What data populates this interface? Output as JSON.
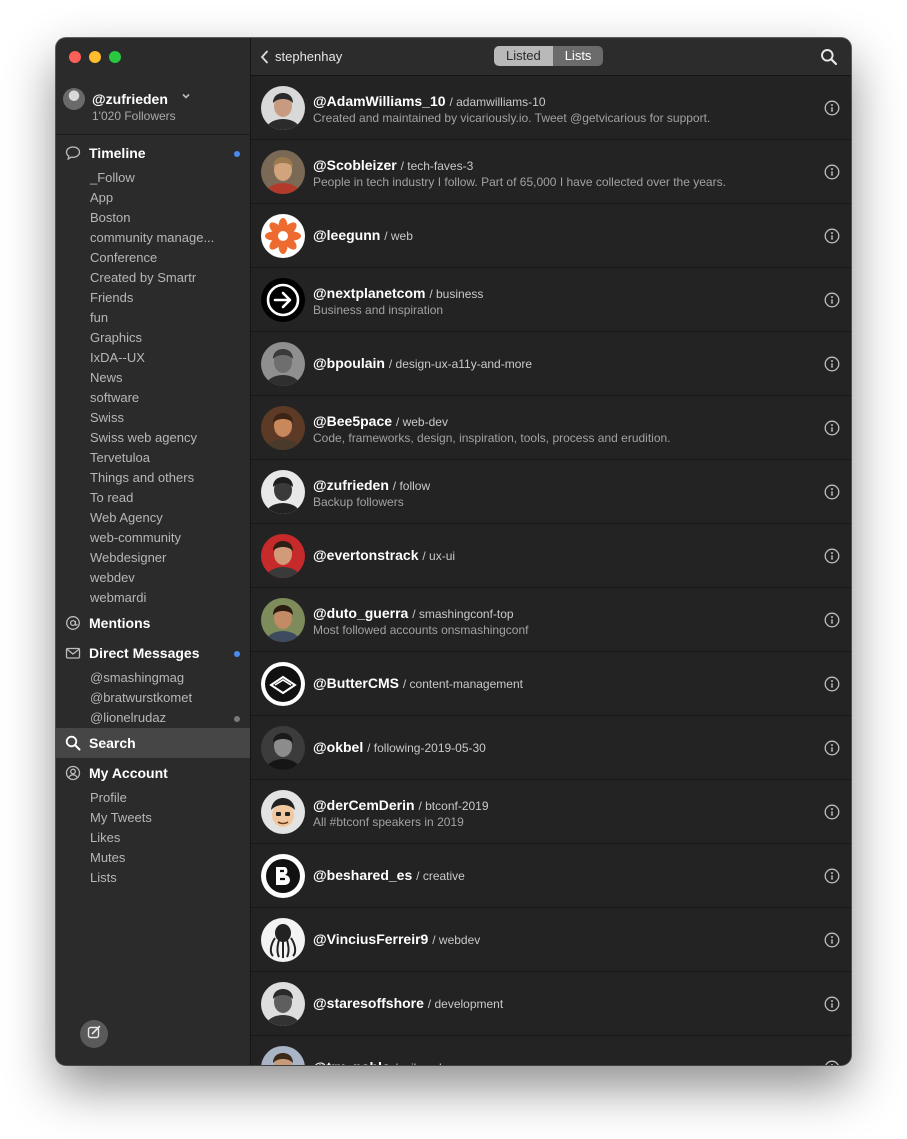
{
  "sidebar": {
    "account": {
      "handle": "@zufrieden",
      "followers": "1'020 Followers"
    },
    "timeline": {
      "label": "Timeline",
      "lists": [
        "_Follow",
        "App",
        "Boston",
        "community manage...",
        "Conference",
        "Created by Smartr",
        "Friends",
        "fun",
        "Graphics",
        "IxDA--UX",
        "News",
        "software",
        "Swiss",
        "Swiss web agency",
        "Tervetuloa",
        "Things and others",
        "To read",
        "Web Agency",
        "web-community",
        "Webdesigner",
        "webdev",
        "webmardi"
      ]
    },
    "mentions": {
      "label": "Mentions"
    },
    "direct_messages": {
      "label": "Direct Messages",
      "threads": [
        "@smashingmag",
        "@bratwurstkomet",
        "@lionelrudaz"
      ]
    },
    "search": {
      "label": "Search"
    },
    "my_account": {
      "label": "My Account",
      "items": [
        "Profile",
        "My Tweets",
        "Likes",
        "Mutes",
        "Lists"
      ]
    }
  },
  "header": {
    "back_label": "stephenhay",
    "segments": [
      "Listed",
      "Lists"
    ]
  },
  "rows": [
    {
      "handle": "@AdamWilliams_10",
      "slug": "/ adamwilliams-10",
      "desc": "Created and maintained by vicariously.io. Tweet @getvicarious for support.",
      "avatar": "photo-a"
    },
    {
      "handle": "@Scobleizer",
      "slug": "/ tech-faves-3",
      "desc": "People in tech industry I follow. Part of 65,000 I have collected over the years.",
      "avatar": "photo-b"
    },
    {
      "handle": "@leegunn",
      "slug": "/ web",
      "desc": "",
      "avatar": "orange-flower"
    },
    {
      "handle": "@nextplanetcom",
      "slug": "/ business",
      "desc": "Business and inspiration",
      "avatar": "arrow-logo"
    },
    {
      "handle": "@bpoulain",
      "slug": "/ design-ux-a11y-and-more",
      "desc": "",
      "avatar": "photo-c"
    },
    {
      "handle": "@Bee5pace",
      "slug": "/ web-dev",
      "desc": "Code, frameworks, design, inspiration, tools, process and erudition.",
      "avatar": "photo-d"
    },
    {
      "handle": "@zufrieden",
      "slug": "/ follow",
      "desc": "Backup followers",
      "avatar": "photo-e"
    },
    {
      "handle": "@evertonstrack",
      "slug": "/ ux-ui",
      "desc": "",
      "avatar": "photo-red"
    },
    {
      "handle": "@duto_guerra",
      "slug": "/ smashingconf-top",
      "desc": "Most followed accounts onsmashingconf",
      "avatar": "photo-f"
    },
    {
      "handle": "@ButterCMS",
      "slug": "/ content-management",
      "desc": "",
      "avatar": "butter-logo"
    },
    {
      "handle": "@okbel",
      "slug": "/ following-2019-05-30",
      "desc": "",
      "avatar": "photo-g"
    },
    {
      "handle": "@derCemDerin",
      "slug": "/ btconf-2019",
      "desc": "All #btconf speakers in 2019",
      "avatar": "cartoon"
    },
    {
      "handle": "@beshared_es",
      "slug": "/ creative",
      "desc": "",
      "avatar": "b-logo"
    },
    {
      "handle": "@VinciusFerreir9",
      "slug": "/ webdev",
      "desc": "",
      "avatar": "octopus"
    },
    {
      "handle": "@staresoffshore",
      "slug": "/ development",
      "desc": "",
      "avatar": "photo-h"
    },
    {
      "handle": "@tru_pablo",
      "slug": "/ mikesub",
      "desc": "",
      "avatar": "photo-i"
    }
  ],
  "colors": {
    "accent_dot": "#4a8cf0",
    "window_bg": "#232323",
    "sidebar_bg": "#2b2b2b"
  }
}
